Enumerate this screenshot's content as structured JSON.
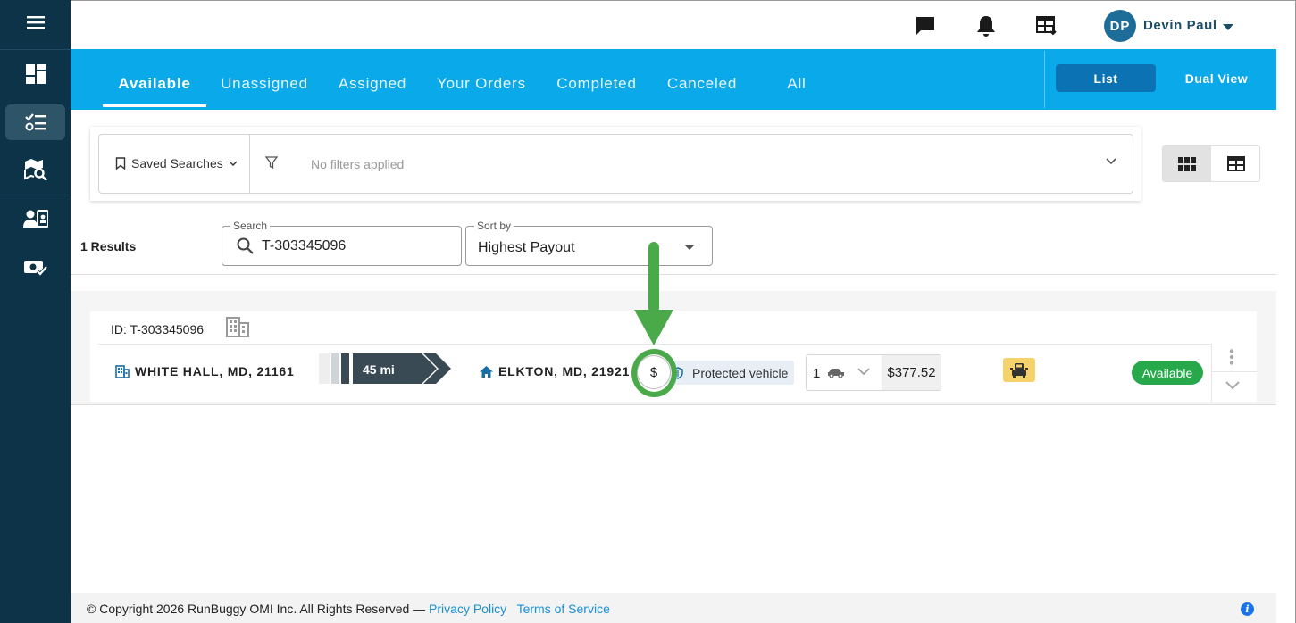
{
  "sidebar": {
    "menu_icon": "hamburger-menu-icon",
    "items": [
      {
        "icon": "dashboard-icon",
        "active": false
      },
      {
        "icon": "orders-list-icon",
        "active": true
      },
      {
        "icon": "map-search-icon",
        "active": false
      },
      {
        "icon": "users-icon",
        "active": false
      },
      {
        "icon": "payment-check-icon",
        "active": false
      }
    ]
  },
  "header": {
    "icons": [
      "chat-icon",
      "bell-icon",
      "table-export-icon"
    ],
    "user": {
      "initials": "DP",
      "name": "Devin Paul"
    }
  },
  "tabs": [
    {
      "label": "Available",
      "active": true
    },
    {
      "label": "Unassigned",
      "active": false
    },
    {
      "label": "Assigned",
      "active": false
    },
    {
      "label": "Your Orders",
      "active": false
    },
    {
      "label": "Completed",
      "active": false
    },
    {
      "label": "Canceled",
      "active": false
    },
    {
      "label": "All",
      "active": false
    }
  ],
  "view_buttons": {
    "list": "List",
    "dual": "Dual View"
  },
  "filters": {
    "saved_searches": "Saved Searches",
    "status": "No filters applied"
  },
  "results": {
    "count_text": "1 Results"
  },
  "search": {
    "label": "Search",
    "value": "T-303345096"
  },
  "sort": {
    "label": "Sort by",
    "value": "Highest Payout"
  },
  "order": {
    "id_text": "ID: T-303345096",
    "pickup": "WHITE HALL, MD, 21161",
    "distance": "45 mi",
    "dropoff": "ELKTON, MD, 21921",
    "payment_symbol": "$",
    "protected_label": "Protected vehicle",
    "vehicle_count": "1",
    "price": "$377.52",
    "status": "Available"
  },
  "footer": {
    "copyright": "© Copyright 2026 RunBuggy OMI Inc. All Rights Reserved —",
    "privacy": "Privacy Policy",
    "terms": "Terms of Service",
    "info": "i"
  },
  "colors": {
    "sidebar": "#0d3349",
    "tabbar": "#0aa9ea",
    "list_button": "#0b73b4",
    "status_available": "#27a84a",
    "annotation": "#4aaa4a"
  }
}
